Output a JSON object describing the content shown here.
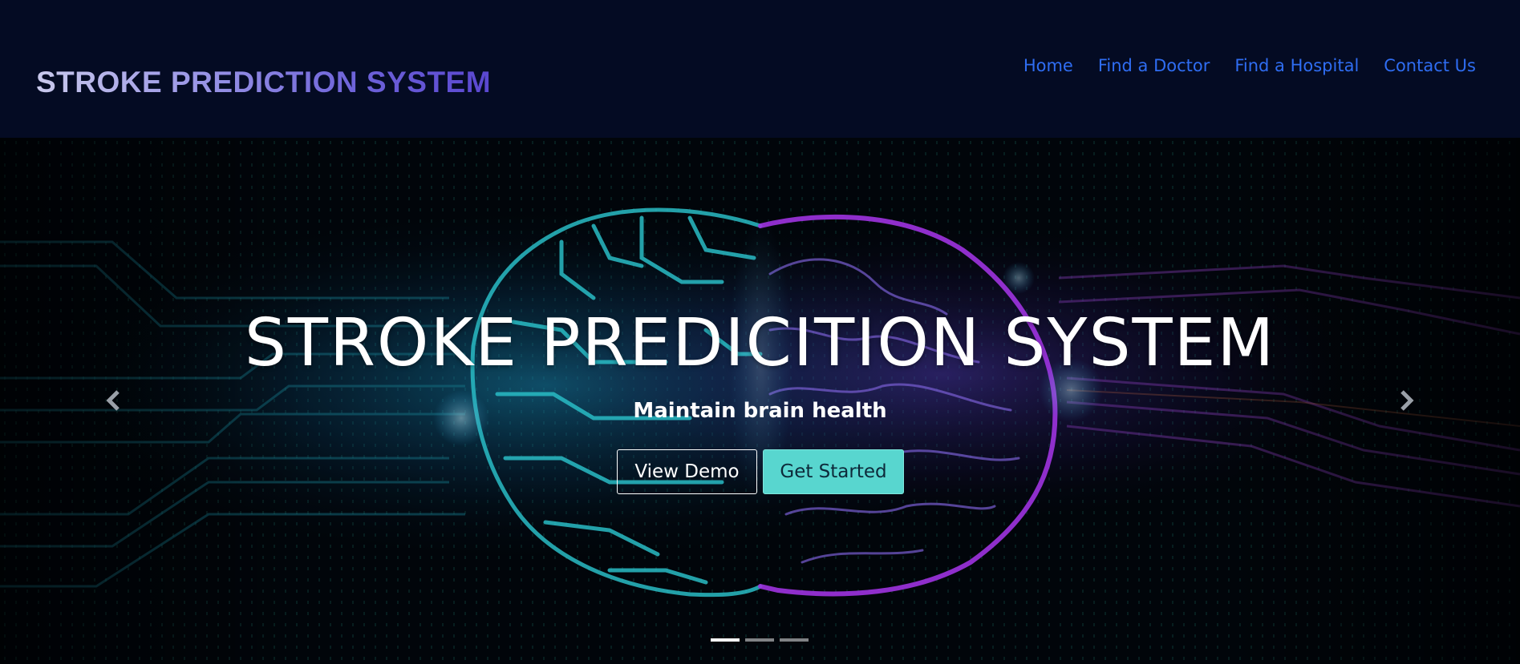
{
  "navbar": {
    "brand": "STROKE PREDICTION SYSTEM",
    "links": [
      "Home",
      "Find a Doctor",
      "Find a Hospital",
      "Contact Us"
    ]
  },
  "hero": {
    "title": "STROKE PREDICITION SYSTEM",
    "subtitle": "Maintain brain health",
    "buttons": {
      "demo": "View Demo",
      "start": "Get Started"
    },
    "prev_icon": "chevron-left-icon",
    "next_icon": "chevron-right-icon",
    "slides": 3,
    "active_slide": 1
  },
  "colors": {
    "nav_bg": "#040b23",
    "nav_link": "#2f6df2",
    "cyan_accent": "#58d6cf",
    "magenta_accent": "#c43bff"
  }
}
